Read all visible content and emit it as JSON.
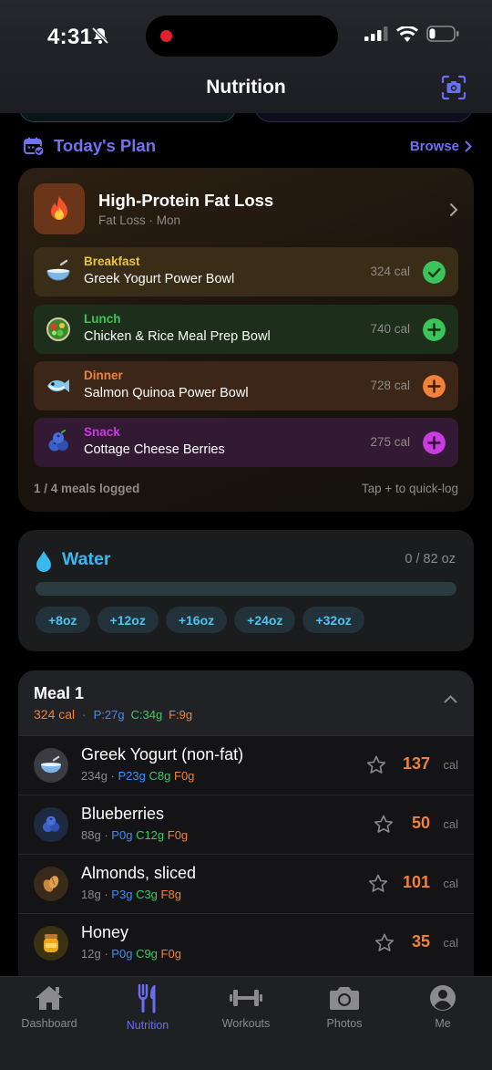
{
  "status": {
    "time": "4:31"
  },
  "nav": {
    "title": "Nutrition"
  },
  "plan_section": {
    "title": "Today's Plan",
    "browse": "Browse"
  },
  "plan": {
    "title": "High-Protein Fat Loss",
    "subtitle": "Fat Loss · Mon",
    "meals": [
      {
        "type": "Breakfast",
        "name": "Greek Yogurt Power Bowl",
        "cal": "324 cal",
        "color": "#e8c534",
        "state": "logged"
      },
      {
        "type": "Lunch",
        "name": "Chicken & Rice Meal Prep Bowl",
        "cal": "740 cal",
        "color": "#3cc45c",
        "state": "add"
      },
      {
        "type": "Dinner",
        "name": "Salmon Quinoa Power Bowl",
        "cal": "728 cal",
        "color": "#f0823a",
        "state": "add"
      },
      {
        "type": "Snack",
        "name": "Cottage Cheese Berries",
        "cal": "275 cal",
        "color": "#c83ce0",
        "state": "add"
      }
    ],
    "footer_left": "1 / 4 meals logged",
    "footer_right": "Tap + to quick-log"
  },
  "water": {
    "title": "Water",
    "amount": "0 / 82 oz",
    "progress": 0,
    "buttons": [
      "+8oz",
      "+12oz",
      "+16oz",
      "+24oz",
      "+32oz"
    ]
  },
  "meal1": {
    "title": "Meal 1",
    "cal": "324 cal",
    "sep": "·",
    "p": "P:27g",
    "c": "C:34g",
    "f": "F:9g",
    "foods": [
      {
        "name": "Greek Yogurt (non-fat)",
        "grams": "234g",
        "sep": "·",
        "p": "P23g",
        "c": "C8g",
        "f": "F0g",
        "cal": "137",
        "unit": "cal",
        "icon": "bowl-icon"
      },
      {
        "name": "Blueberries",
        "grams": "88g",
        "sep": "·",
        "p": "P0g",
        "c": "C12g",
        "f": "F0g",
        "cal": "50",
        "unit": "cal",
        "icon": "blueberries-icon"
      },
      {
        "name": "Almonds, sliced",
        "grams": "18g",
        "sep": "·",
        "p": "P3g",
        "c": "C3g",
        "f": "F8g",
        "cal": "101",
        "unit": "cal",
        "icon": "nuts-icon"
      },
      {
        "name": "Honey",
        "grams": "12g",
        "sep": "·",
        "p": "P0g",
        "c": "C9g",
        "f": "F0g",
        "cal": "35",
        "unit": "cal",
        "icon": "honey-icon"
      }
    ]
  },
  "tabs": [
    {
      "label": "Dashboard",
      "active": false
    },
    {
      "label": "Nutrition",
      "active": true
    },
    {
      "label": "Workouts",
      "active": false
    },
    {
      "label": "Photos",
      "active": false
    },
    {
      "label": "Me",
      "active": false
    }
  ],
  "colors": {
    "accent": "#6a6ef0",
    "water": "#38b8ee",
    "calories": "#f0823a",
    "protein": "#3e8ef5",
    "carbs": "#42c766",
    "fat": "#f0823a"
  }
}
